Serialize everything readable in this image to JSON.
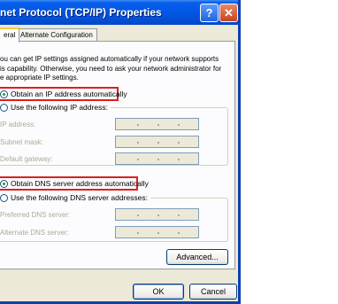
{
  "window": {
    "title": "net Protocol (TCP/IP) Properties"
  },
  "titlebar": {
    "help_symbol": "?",
    "close_symbol": "✕"
  },
  "tabs": [
    {
      "label": "eral",
      "active": true
    },
    {
      "label": "Alternate Configuration",
      "active": false
    }
  ],
  "intro_text": "You can get IP settings assigned automatically if your network supports this capability. Otherwise, you need to ask your network administrator for the appropriate IP settings.",
  "intro_lines": [
    "ou can get IP settings assigned automatically if your network supports",
    "is capability. Otherwise, you need to ask your network administrator for",
    "e appropriate IP settings."
  ],
  "ip_section": {
    "auto_label": "Obtain an IP address automatically",
    "auto_checked": true,
    "manual_label": "Use the following IP address:",
    "fields": [
      {
        "label": "IP address:"
      },
      {
        "label": "Subnet mask:"
      },
      {
        "label": "Default gateway:"
      }
    ]
  },
  "dns_section": {
    "auto_label": "Obtain DNS server address automatically",
    "auto_checked": true,
    "manual_label": "Use the following DNS server addresses:",
    "fields": [
      {
        "label": "Preferred DNS server:"
      },
      {
        "label": "Alternate DNS server:"
      }
    ]
  },
  "buttons": {
    "advanced": "Advanced...",
    "ok": "OK",
    "cancel": "Cancel"
  },
  "colors": {
    "titlebar": "#0058E6",
    "highlight": "#E01E1E",
    "dialog_bg": "#ECE9D8"
  }
}
